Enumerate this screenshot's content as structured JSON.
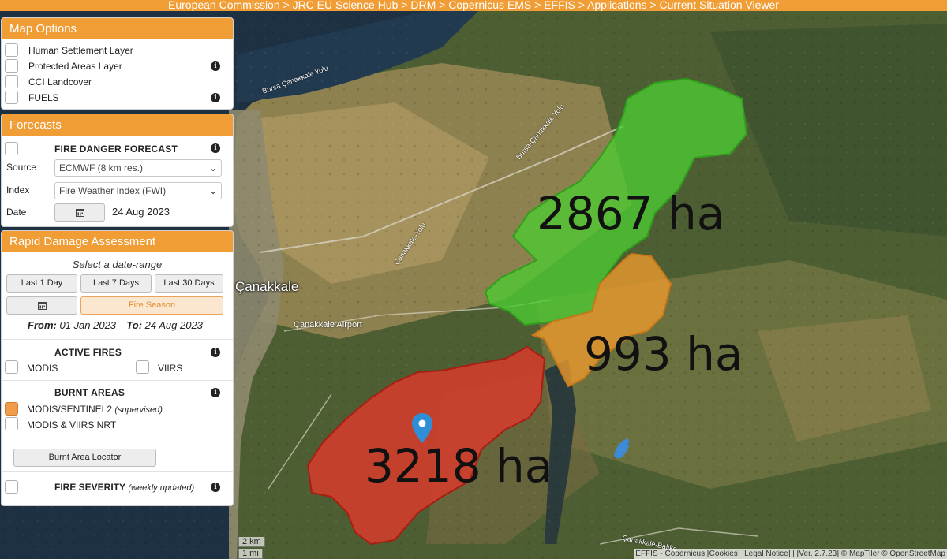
{
  "topbar": {
    "breadcrumb": "European Commission > JRC EU Science Hub > DRM > Copernicus EMS > EFFIS > Applications > Current Situation Viewer"
  },
  "map_options": {
    "title": "Map Options",
    "layers": [
      {
        "label": "Human Settlement Layer",
        "checked": false,
        "info": false
      },
      {
        "label": "Protected Areas Layer",
        "checked": false,
        "info": true
      },
      {
        "label": "CCI Landcover",
        "checked": false,
        "info": false
      },
      {
        "label": "FUELS",
        "checked": false,
        "info": true
      }
    ]
  },
  "forecasts": {
    "title": "Forecasts",
    "fire_danger_label": "FIRE DANGER FORECAST",
    "source_label": "Source",
    "source_value": "ECMWF (8 km res.)",
    "index_label": "Index",
    "index_value": "Fire Weather Index (FWI)",
    "date_label": "Date",
    "date_value": "24 Aug 2023"
  },
  "rapid": {
    "title": "Rapid Damage Assessment",
    "select_range": "Select a date-range",
    "btn_last1": "Last 1 Day",
    "btn_last7": "Last 7 Days",
    "btn_last30": "Last 30 Days",
    "btn_fire_season": "Fire Season",
    "from_label": "From:",
    "from_value": "01 Jan 2023",
    "to_label": "To:",
    "to_value": "24 Aug 2023",
    "active_fires_label": "ACTIVE FIRES",
    "modis_label": "MODIS",
    "viirs_label": "VIIRS",
    "burnt_areas_label": "BURNT AREAS",
    "modis_sentinel_label": "MODIS/SENTINEL2",
    "supervised_label": "(supervised)",
    "modis_viirs_nrt_label": "MODIS & VIIRS NRT",
    "burnt_locator_label": "Burnt Area Locator",
    "fire_severity_label": "FIRE SEVERITY",
    "weekly_updated_label": "(weekly updated)"
  },
  "map": {
    "city": "Çanakkale",
    "airport": "Çanakkale Airport",
    "roads": [
      "Bursa Çanakkale Yolu",
      "Bursa-Çanakkale Yolu",
      "Çanakkale-Balıke",
      "Çanakkale-Yolu"
    ],
    "fires": [
      {
        "label": "2867 ha",
        "color": "#49c52e"
      },
      {
        "label": "993 ha",
        "color": "#e9972e"
      },
      {
        "label": "3218 ha",
        "color": "#dd3a2b"
      }
    ],
    "scale_km": "2 km",
    "scale_mi": "1 mi",
    "attribution": "EFFIS - Copernicus [Cookies] [Legal Notice] | [Ver. 2.7.23] © MapTiler © OpenStreetMap"
  },
  "colors": {
    "accent": "#f19d35",
    "active_button": "#fbe6cf"
  }
}
